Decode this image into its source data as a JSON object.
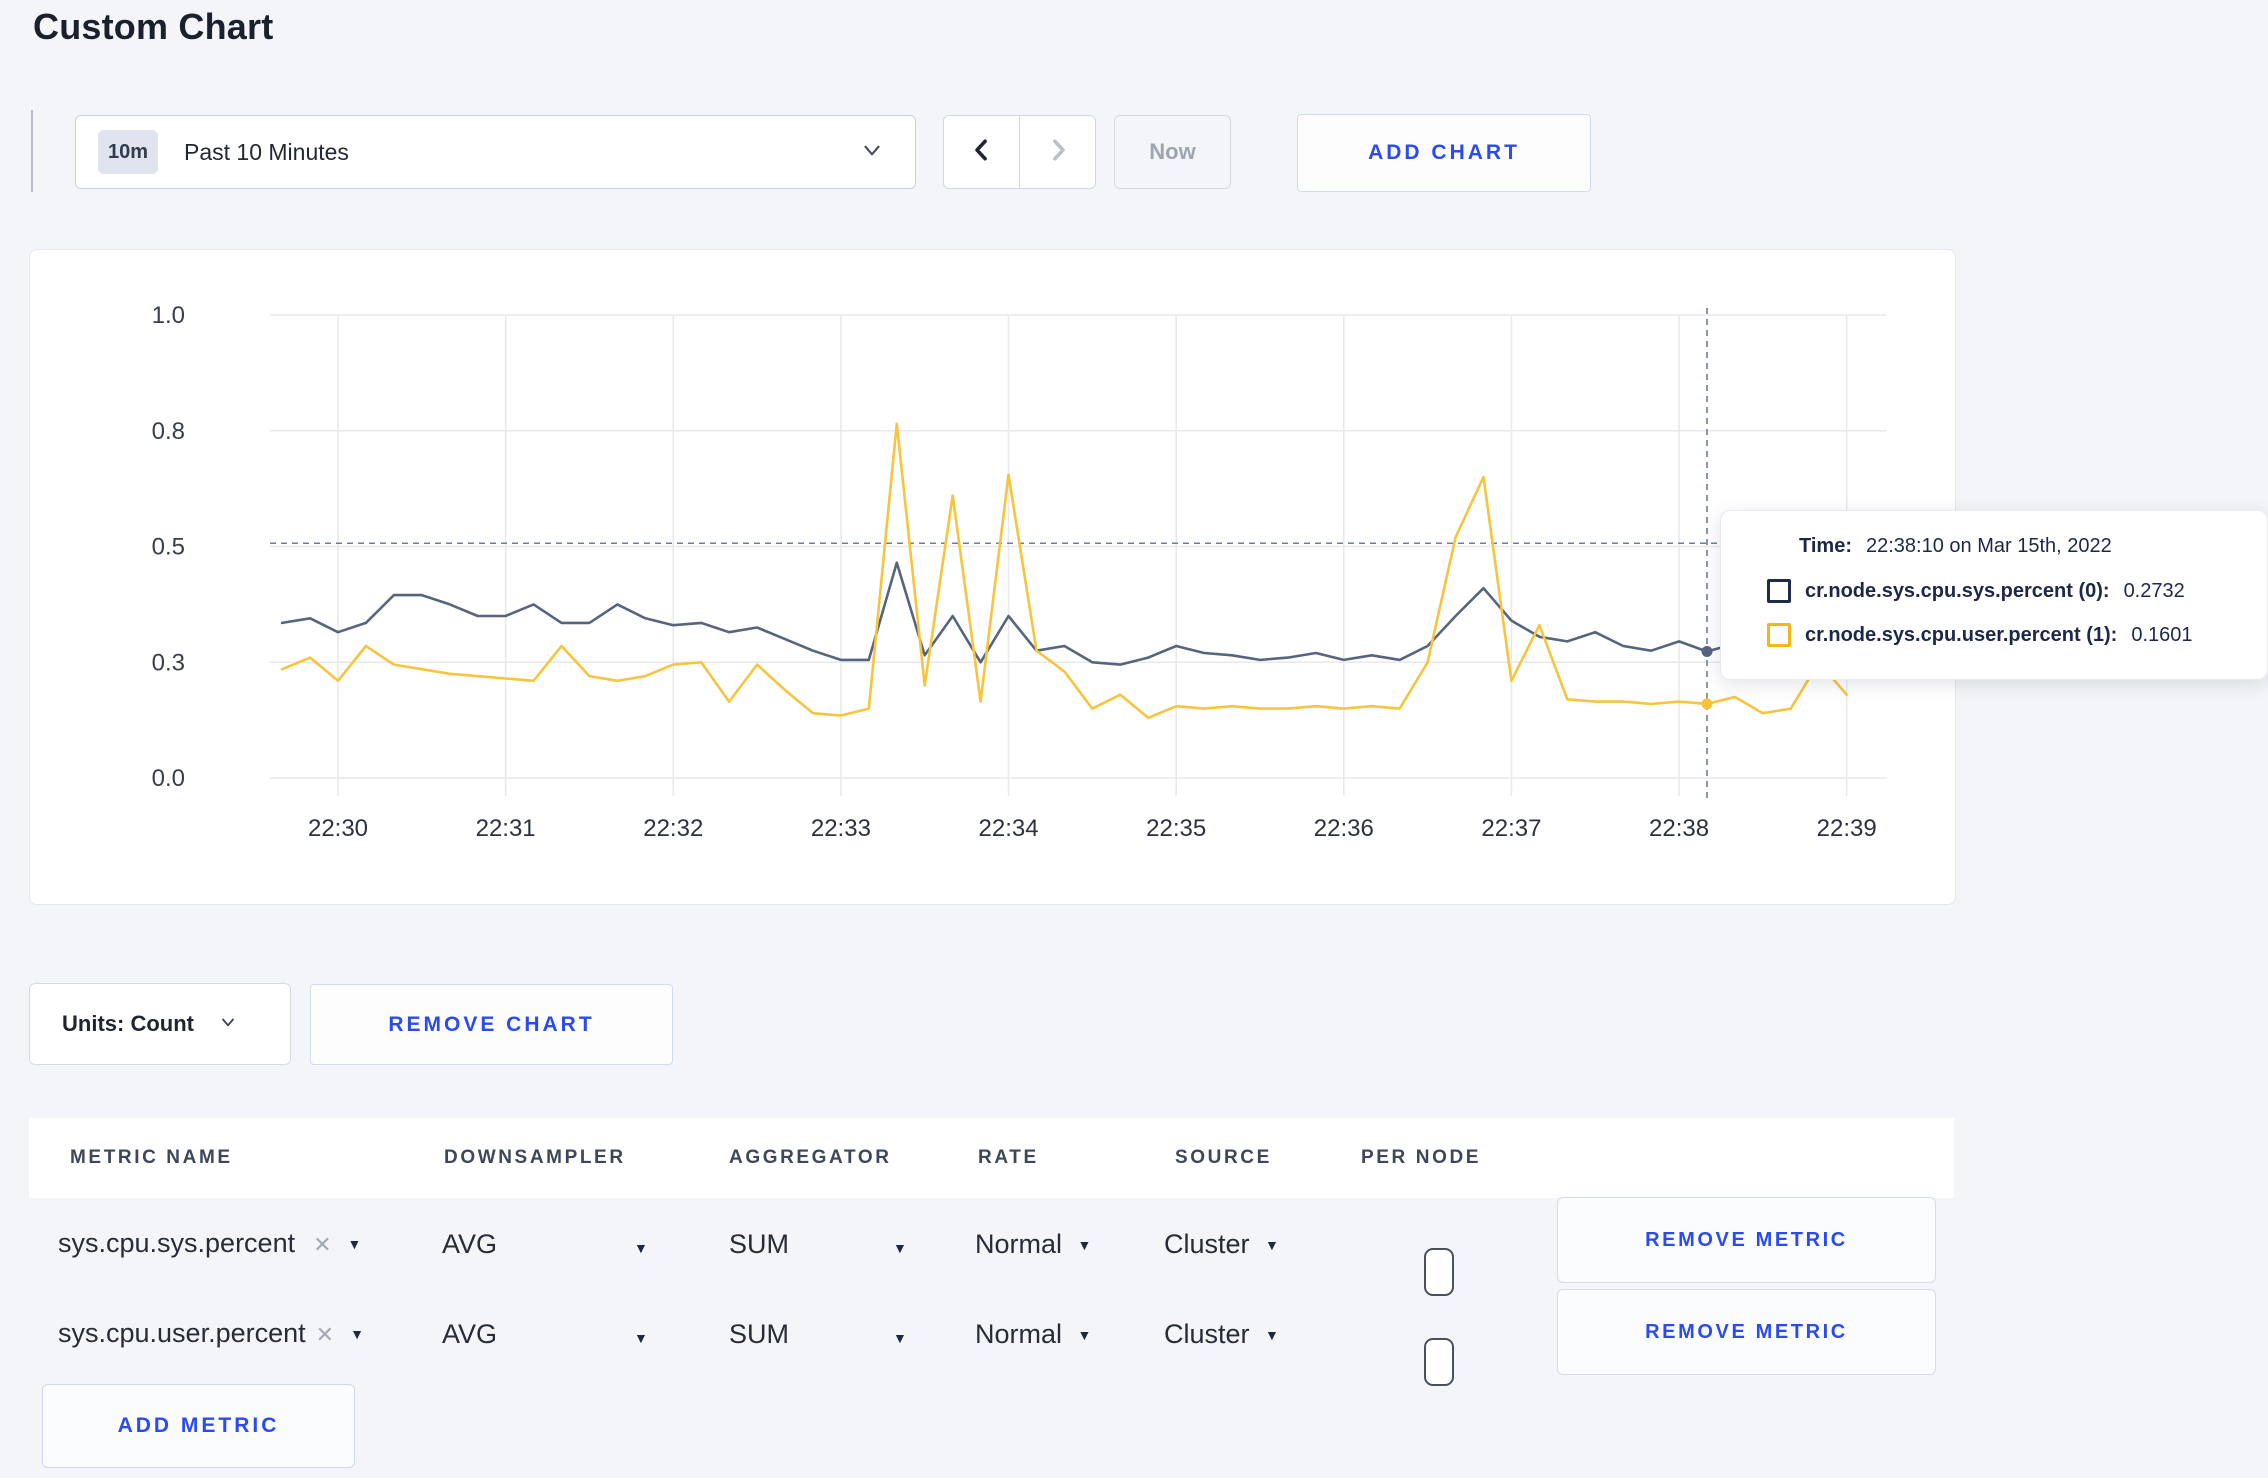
{
  "page": {
    "title": "Custom Chart"
  },
  "toolbar": {
    "time_badge": "10m",
    "time_range_label": "Past 10 Minutes",
    "now_label": "Now",
    "add_chart_label": "ADD CHART"
  },
  "chart_controls": {
    "units_label": "Units: Count",
    "remove_chart_label": "REMOVE CHART"
  },
  "tooltip": {
    "time_label": "Time:",
    "time_value": "22:38:10 on Mar 15th, 2022",
    "series": [
      {
        "label": "cr.node.sys.cpu.sys.percent (0):",
        "value": "0.2732",
        "color": "#202a4d"
      },
      {
        "label": "cr.node.sys.cpu.user.percent (1):",
        "value": "0.1601",
        "color": "#f2b713"
      }
    ]
  },
  "metrics_table": {
    "headers": [
      "METRIC NAME",
      "DOWNSAMPLER",
      "AGGREGATOR",
      "RATE",
      "SOURCE",
      "PER NODE"
    ],
    "rows": [
      {
        "metric": "sys.cpu.sys.percent",
        "downsampler": "AVG",
        "aggregator": "SUM",
        "rate": "Normal",
        "source": "Cluster",
        "per_node_checked": false,
        "remove_label": "REMOVE METRIC"
      },
      {
        "metric": "sys.cpu.user.percent",
        "downsampler": "AVG",
        "aggregator": "SUM",
        "rate": "Normal",
        "source": "Cluster",
        "per_node_checked": false,
        "remove_label": "REMOVE METRIC"
      }
    ],
    "add_metric_label": "ADD METRIC"
  },
  "chart_data": {
    "type": "line",
    "title": "",
    "xlabel": "",
    "ylabel": "",
    "ylim": [
      0,
      1
    ],
    "grid": true,
    "x_tick_labels": [
      "22:30",
      "22:31",
      "22:32",
      "22:33",
      "22:34",
      "22:35",
      "22:36",
      "22:37",
      "22:38",
      "22:39"
    ],
    "y_tick_labels": [
      "0.0",
      "0.3",
      "0.5",
      "0.8",
      "1.0"
    ],
    "y_tick_values": [
      0,
      0.25,
      0.5,
      0.75,
      1.0
    ],
    "x_start": "22:29:40",
    "x_step_seconds": 10,
    "series": [
      {
        "name": "cr.node.sys.cpu.sys.percent (0)",
        "color": "#56657f",
        "values": [
          0.335,
          0.345,
          0.315,
          0.335,
          0.395,
          0.395,
          0.375,
          0.35,
          0.35,
          0.375,
          0.335,
          0.335,
          0.375,
          0.345,
          0.33,
          0.335,
          0.315,
          0.325,
          0.3,
          0.275,
          0.255,
          0.255,
          0.465,
          0.265,
          0.35,
          0.25,
          0.35,
          0.275,
          0.285,
          0.25,
          0.245,
          0.26,
          0.285,
          0.27,
          0.265,
          0.255,
          0.26,
          0.27,
          0.255,
          0.265,
          0.255,
          0.285,
          0.35,
          0.41,
          0.34,
          0.305,
          0.295,
          0.315,
          0.285,
          0.275,
          0.295,
          0.2732,
          0.29,
          0.285,
          0.29,
          0.28,
          0.27
        ]
      },
      {
        "name": "cr.node.sys.cpu.user.percent (1)",
        "color": "#f8c43e",
        "values": [
          0.235,
          0.26,
          0.21,
          0.285,
          0.245,
          0.235,
          0.225,
          0.22,
          0.215,
          0.21,
          0.285,
          0.22,
          0.21,
          0.22,
          0.245,
          0.25,
          0.165,
          0.245,
          0.19,
          0.14,
          0.135,
          0.15,
          0.765,
          0.2,
          0.61,
          0.165,
          0.655,
          0.275,
          0.23,
          0.15,
          0.18,
          0.13,
          0.155,
          0.15,
          0.155,
          0.15,
          0.15,
          0.155,
          0.15,
          0.155,
          0.15,
          0.25,
          0.52,
          0.65,
          0.21,
          0.33,
          0.17,
          0.165,
          0.165,
          0.16,
          0.165,
          0.1601,
          0.175,
          0.14,
          0.15,
          0.25,
          0.18
        ]
      }
    ],
    "crosshair": {
      "time": "22:38:10",
      "y_value": 0.507,
      "marker_values": [
        0.2732,
        0.1601
      ]
    }
  }
}
